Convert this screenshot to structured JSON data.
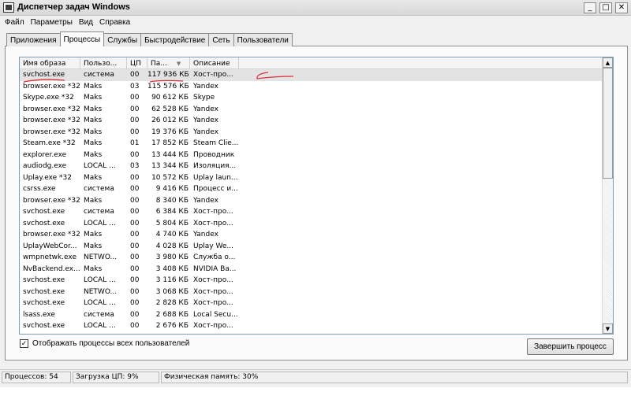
{
  "window": {
    "title": "Диспетчер задач Windows",
    "buttons": {
      "minimize": "_",
      "maximize": "□",
      "close": "✕"
    }
  },
  "menu": [
    "Файл",
    "Параметры",
    "Вид",
    "Справка"
  ],
  "tabs": [
    {
      "label": "Приложения",
      "active": false
    },
    {
      "label": "Процессы",
      "active": true
    },
    {
      "label": "Службы",
      "active": false
    },
    {
      "label": "Быстродействие",
      "active": false
    },
    {
      "label": "Сеть",
      "active": false
    },
    {
      "label": "Пользователи",
      "active": false
    }
  ],
  "columns": [
    "Имя образа",
    "Пользо...",
    "ЦП",
    "Па...",
    "Описание"
  ],
  "sort_indicator": "▼",
  "processes": [
    [
      "svchost.exe",
      "система",
      "00",
      "117 936 КБ",
      "Хост-про..."
    ],
    [
      "browser.exe *32",
      "Maks",
      "03",
      "115 576 КБ",
      "Yandex"
    ],
    [
      "Skype.exe *32",
      "Maks",
      "00",
      "90 612 КБ",
      "Skype"
    ],
    [
      "browser.exe *32",
      "Maks",
      "00",
      "62 528 КБ",
      "Yandex"
    ],
    [
      "browser.exe *32",
      "Maks",
      "00",
      "26 012 КБ",
      "Yandex"
    ],
    [
      "browser.exe *32",
      "Maks",
      "00",
      "19 376 КБ",
      "Yandex"
    ],
    [
      "Steam.exe *32",
      "Maks",
      "01",
      "17 852 КБ",
      "Steam Clie..."
    ],
    [
      "explorer.exe",
      "Maks",
      "00",
      "13 444 КБ",
      "Проводник"
    ],
    [
      "audiodg.exe",
      "LOCAL ...",
      "03",
      "13 344 КБ",
      "Изоляция..."
    ],
    [
      "Uplay.exe *32",
      "Maks",
      "00",
      "10 572 КБ",
      "Uplay laun..."
    ],
    [
      "csrss.exe",
      "система",
      "00",
      "9 416 КБ",
      "Процесс и..."
    ],
    [
      "browser.exe *32",
      "Maks",
      "00",
      "8 340 КБ",
      "Yandex"
    ],
    [
      "svchost.exe",
      "система",
      "00",
      "6 384 КБ",
      "Хост-про..."
    ],
    [
      "svchost.exe",
      "LOCAL ...",
      "00",
      "5 804 КБ",
      "Хост-про..."
    ],
    [
      "browser.exe *32",
      "Maks",
      "00",
      "4 740 КБ",
      "Yandex"
    ],
    [
      "UplayWebCor...",
      "Maks",
      "00",
      "4 028 КБ",
      "Uplay We..."
    ],
    [
      "wmpnetwk.exe",
      "NETWO...",
      "00",
      "3 980 КБ",
      "Служба о..."
    ],
    [
      "NvBackend.ex...",
      "Maks",
      "00",
      "3 408 КБ",
      "NVIDIA Ba..."
    ],
    [
      "svchost.exe",
      "LOCAL ...",
      "00",
      "3 116 КБ",
      "Хост-про..."
    ],
    [
      "svchost.exe",
      "NETWO...",
      "00",
      "3 068 КБ",
      "Хост-про..."
    ],
    [
      "svchost.exe",
      "LOCAL ...",
      "00",
      "2 828 КБ",
      "Хост-про..."
    ],
    [
      "lsass.exe",
      "система",
      "00",
      "2 688 КБ",
      "Local Secu..."
    ],
    [
      "svchost.exe",
      "LOCAL ...",
      "00",
      "2 676 КБ",
      "Хост-про..."
    ]
  ],
  "selected_row": 0,
  "show_all_users": {
    "label": "Отображать процессы всех пользователей",
    "checked": true
  },
  "end_process_button": "Завершить процесс",
  "status": {
    "processes": "Процессов: 54",
    "cpu": "Загрузка ЦП: 9%",
    "memory": "Физическая память: 30%"
  },
  "colors": {
    "selection": "#e3e3e3",
    "annotation": "#d9303a"
  }
}
